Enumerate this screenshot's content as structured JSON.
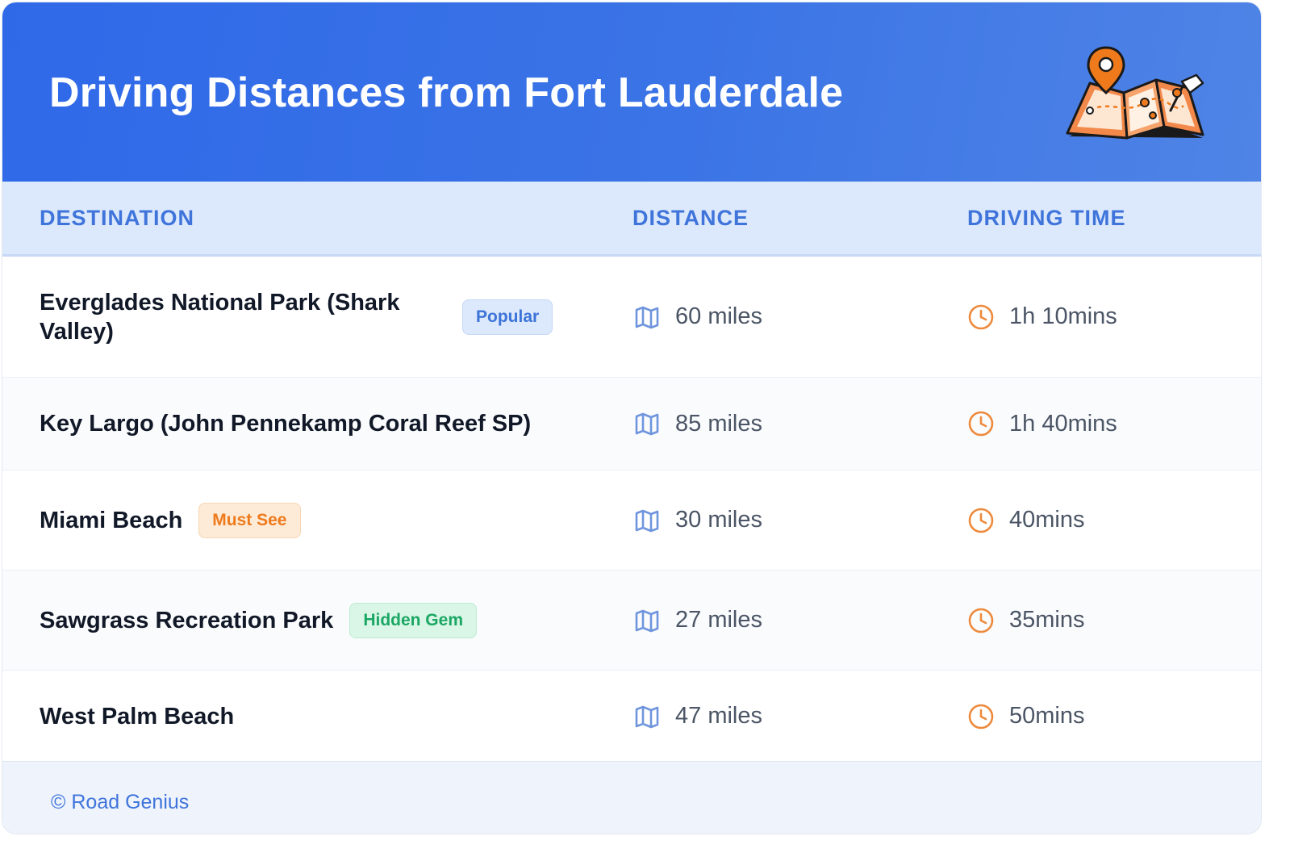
{
  "header": {
    "title": "Driving Distances from Fort Lauderdale",
    "illustration": "map-with-pins-icon",
    "gradient_colors": [
      "#2f69e8",
      "#4f84e6"
    ]
  },
  "table": {
    "columns": [
      "DESTINATION",
      "DISTANCE",
      "DRIVING TIME"
    ],
    "rows": [
      {
        "destination": "Everglades National Park (Shark Valley)",
        "badge": "Popular",
        "badge_color": "blue",
        "distance": "60 miles",
        "time": "1h 10mins"
      },
      {
        "destination": "Key Largo (John Pennekamp Coral Reef SP)",
        "badge": "",
        "badge_color": "",
        "distance": "85 miles",
        "time": "1h 40mins"
      },
      {
        "destination": "Miami Beach",
        "badge": "Must See",
        "badge_color": "orange",
        "distance": "30 miles",
        "time": "40mins"
      },
      {
        "destination": "Sawgrass Recreation Park",
        "badge": "Hidden Gem",
        "badge_color": "green",
        "distance": "27 miles",
        "time": "35mins"
      },
      {
        "destination": "West Palm Beach",
        "badge": "",
        "badge_color": "",
        "distance": "47 miles",
        "time": "50mins"
      }
    ]
  },
  "icons": {
    "distance": "map-icon",
    "time": "clock-icon"
  },
  "colors": {
    "accent": "#3f74db",
    "clock": "#ee8a3c",
    "map_icon": "#6f95dd"
  },
  "footer": {
    "text": "© Road Genius"
  }
}
